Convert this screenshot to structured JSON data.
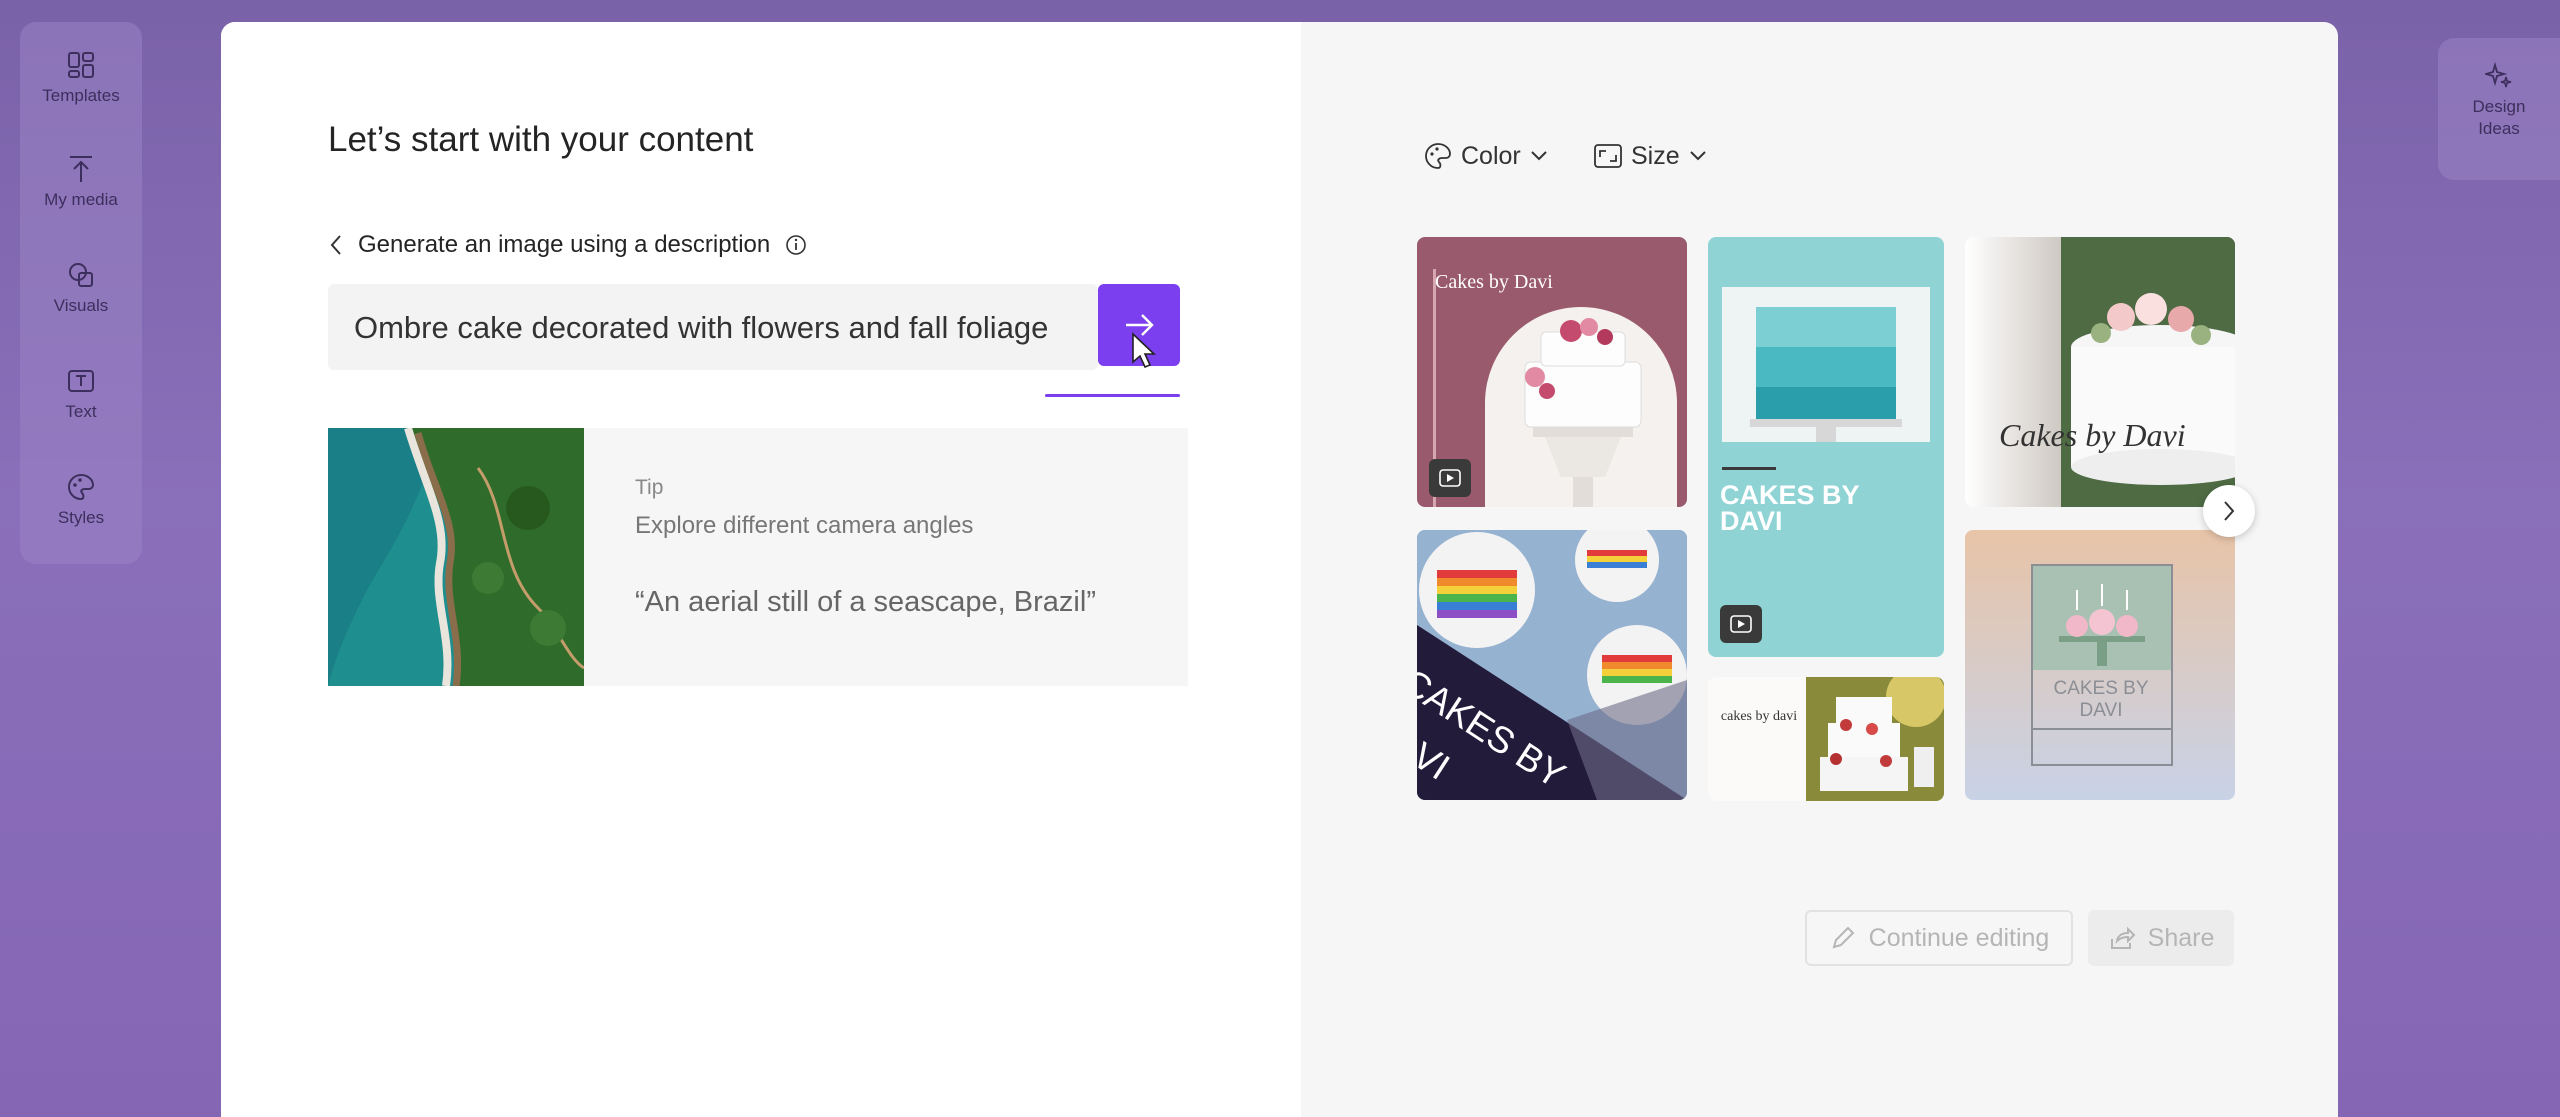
{
  "left_rail": {
    "items": [
      {
        "label": "Templates",
        "icon": "templates-icon"
      },
      {
        "label": "My media",
        "icon": "upload-icon"
      },
      {
        "label": "Visuals",
        "icon": "shapes-icon"
      },
      {
        "label": "Text",
        "icon": "text-icon"
      },
      {
        "label": "Styles",
        "icon": "palette-icon"
      }
    ]
  },
  "right_rail": {
    "label": "Design Ideas",
    "icon": "sparkle-icon"
  },
  "dialog": {
    "title": "Let’s start with your content",
    "back_label": "Generate an image using a description",
    "prompt_value": "Ombre cake decorated with flowers and fall foliage",
    "tip": {
      "label": "Tip",
      "heading": "Explore different camera angles",
      "quote": "“An aerial still of a seascape, Brazil”"
    },
    "filters": {
      "color_label": "Color",
      "size_label": "Size"
    },
    "designs": {
      "card1_text": "Cakes by Davi",
      "card2_text": "CAKES BY DAVI",
      "card3_text": "Cakes by Davi",
      "card4_text": "CAKES BY DAVI",
      "card5_text": "cakes by davi",
      "card6_text": "CAKES BY DAVI"
    },
    "actions": {
      "continue_label": "Continue editing",
      "share_label": "Share"
    }
  },
  "colors": {
    "accent": "#7b3ff0",
    "background": "#8566b5"
  }
}
